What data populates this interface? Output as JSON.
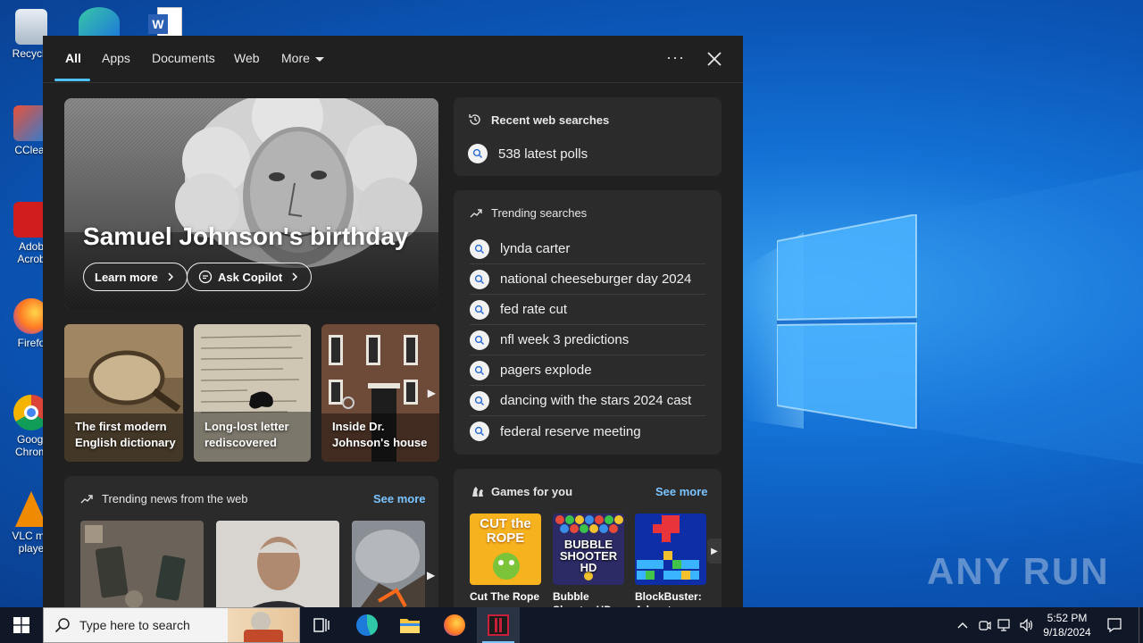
{
  "desktop_icons": [
    {
      "label": "Recycle",
      "icon": "recycle-bin-icon"
    },
    {
      "label": "CClear",
      "icon": "ccleaner-icon"
    },
    {
      "label": "Adob Acrob",
      "icon": "acrobat-icon"
    },
    {
      "label": "Firefo",
      "icon": "firefox-icon"
    },
    {
      "label": "Googl Chrom",
      "icon": "chrome-icon"
    },
    {
      "label": "VLC me playe",
      "icon": "vlc-icon"
    }
  ],
  "tabs": [
    {
      "label": "All",
      "active": true
    },
    {
      "label": "Apps"
    },
    {
      "label": "Documents"
    },
    {
      "label": "Web"
    },
    {
      "label": "More"
    }
  ],
  "toolbar": {
    "more_options": "···"
  },
  "hero": {
    "title": "Samuel Johnson's birthday",
    "learn_more": "Learn more",
    "ask_copilot": "Ask Copilot"
  },
  "sub_cards": [
    {
      "caption": "The first modern English dictionary"
    },
    {
      "caption": "Long-lost letter rediscovered"
    },
    {
      "caption": "Inside Dr. Johnson's house"
    }
  ],
  "news": {
    "title": "Trending news from the web",
    "see_more": "See more"
  },
  "recent": {
    "title": "Recent web searches",
    "items": [
      "538 latest polls"
    ]
  },
  "trending": {
    "title": "Trending searches",
    "items": [
      "lynda carter",
      "national cheeseburger day 2024",
      "fed rate cut",
      "nfl week 3 predictions",
      "pagers explode",
      "dancing with the stars 2024 cast",
      "federal reserve meeting"
    ]
  },
  "games": {
    "title": "Games for you",
    "see_more": "See more",
    "items": [
      {
        "name": "Cut The Rope",
        "art": "CUT the ROPE"
      },
      {
        "name": "Bubble Shooter HD",
        "art": "BUBBLE SHOOTER HD"
      },
      {
        "name": "BlockBuster: Adventure",
        "art": ""
      }
    ]
  },
  "taskbar": {
    "search_placeholder": "Type here to search",
    "time": "5:52 PM",
    "date": "9/18/2024"
  },
  "watermark": {
    "text": "ANY RUN"
  },
  "colors": {
    "accent": "#4cc2ff",
    "link": "#7cc4ff",
    "flyout_bg": "#202020",
    "panel_bg": "#2b2b2b"
  }
}
